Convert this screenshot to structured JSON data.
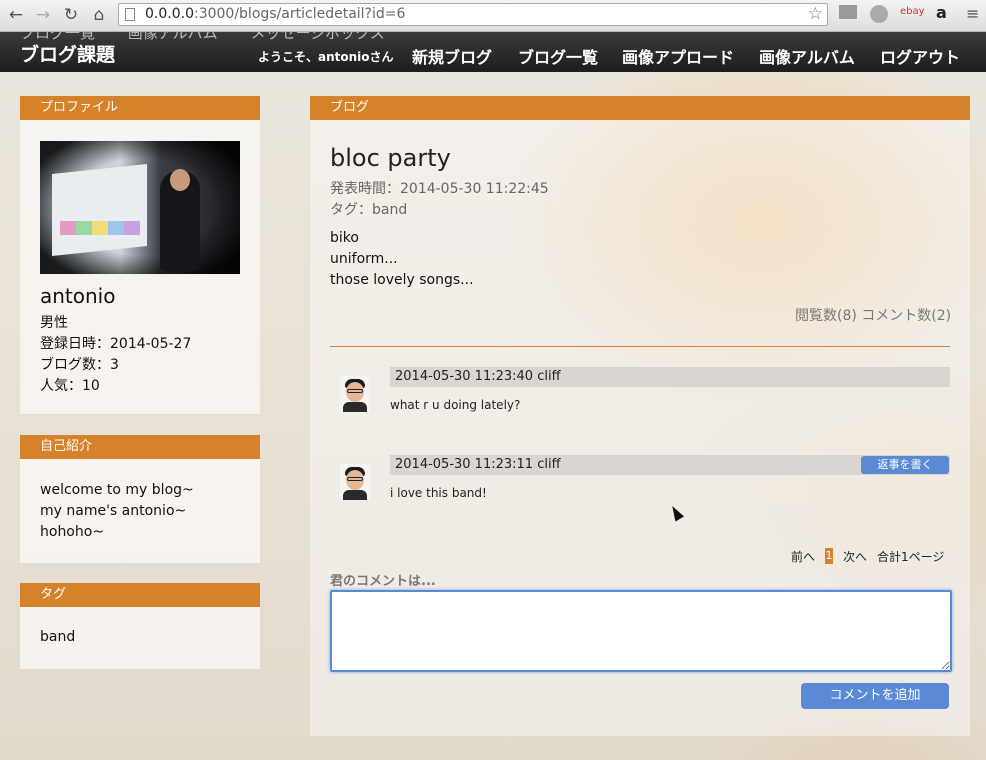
{
  "browser": {
    "url_host": "0.0.0.0",
    "url_path": ":3000/blogs/articledetail?id=6",
    "extensions": [
      "ebay",
      "a"
    ]
  },
  "site": {
    "subnav": [
      "ブログ一覧",
      "画像アルバム",
      "メッセージボックス"
    ],
    "brand": "ブログ課題",
    "welcome": "ようこそ、antonioさん",
    "menu": [
      "新規ブログ",
      "ブログ一覧",
      "画像アプロード",
      "画像アルバム",
      "ログアウト"
    ]
  },
  "profile": {
    "heading": "プロファイル",
    "name": "antonio",
    "gender": "男性",
    "registered": "登録日時：2014-05-27",
    "blog_count": "ブログ数：3",
    "popularity": "人気：10"
  },
  "intro": {
    "heading": "自己紹介",
    "lines": [
      "welcome to my blog~",
      "my name's antonio~",
      "hohoho~"
    ]
  },
  "tags_panel": {
    "heading": "タグ",
    "tag": "band"
  },
  "blog": {
    "heading": "ブログ",
    "title": "bloc party",
    "published": "発表時間：2014-05-30 11:22:45",
    "tags": "タグ：band",
    "body": [
      "biko",
      "uniform...",
      "those lovely songs..."
    ],
    "views": "閲覧数(8)",
    "comments_count": "コメント数(2)"
  },
  "comments": [
    {
      "header": "2014-05-30 11:23:40 cliff",
      "text": "what r u doing lately?"
    },
    {
      "header": "2014-05-30 11:23:11 cliff",
      "text": "i love this band!"
    }
  ],
  "reply_label": "返事を書く",
  "pager": {
    "prev": "前へ",
    "current": "1",
    "next": "次へ",
    "total": "合計1ページ"
  },
  "comment_form": {
    "label": "君のコメントは...",
    "submit": "コメントを追加"
  },
  "colors": {
    "accent": "#d5822a",
    "button": "#5a8ad6",
    "header": "#2a2a2a"
  }
}
